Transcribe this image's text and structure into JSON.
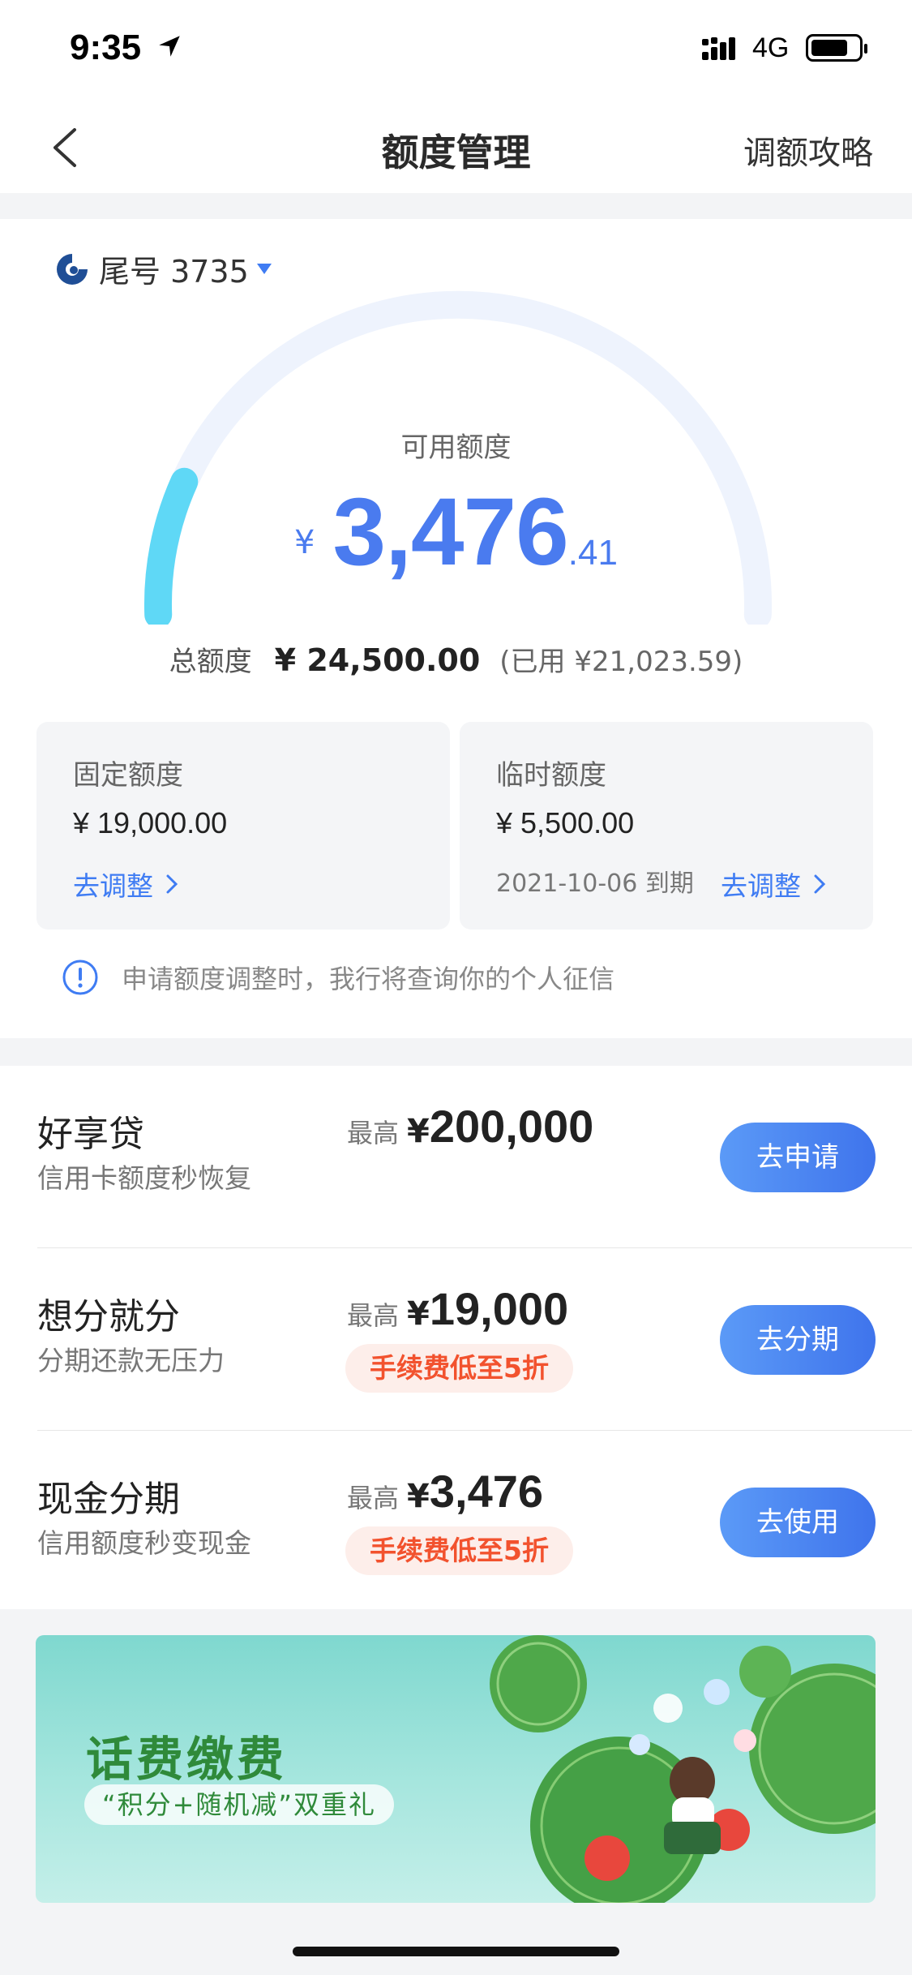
{
  "status_bar": {
    "time": "9:35",
    "network": "4G"
  },
  "nav": {
    "title": "额度管理",
    "right_link": "调额攻略"
  },
  "account": {
    "label": "尾号 3735"
  },
  "available": {
    "label": "可用额度",
    "currency": "¥",
    "integer": "3,476",
    "decimal": ".41",
    "fraction_of_total": 0.142
  },
  "total": {
    "label": "总额度",
    "value": "¥ 24,500.00",
    "used": "(已用 ¥21,023.59)"
  },
  "fixed": {
    "label": "固定额度",
    "value": "¥ 19,000.00",
    "link": "去调整"
  },
  "temp": {
    "label": "临时额度",
    "value": "¥ 5,500.00",
    "expiry": "2021-10-06 到期",
    "link": "去调整"
  },
  "notice": "申请额度调整时，我行将查询你的个人征信",
  "products": [
    {
      "name": "好享贷",
      "sub": "信用卡额度秒恢复",
      "prefix": "最高",
      "yen": "¥",
      "amount": "200,000",
      "tag": "",
      "button": "去申请"
    },
    {
      "name": "想分就分",
      "sub": "分期还款无压力",
      "prefix": "最高",
      "yen": "¥",
      "amount": "19,000",
      "tag": "手续费低至5折",
      "button": "去分期"
    },
    {
      "name": "现金分期",
      "sub": "信用额度秒变现金",
      "prefix": "最高",
      "yen": "¥",
      "amount": "3,476",
      "tag": "手续费低至5折",
      "button": "去使用"
    }
  ],
  "banner": {
    "title": "话费缴费",
    "subtitle": "“积分+随机减”双重礼"
  },
  "colors": {
    "accent": "#3f7cf3",
    "gauge_fill": "#5fd8f6",
    "gauge_track": "#eef3fd",
    "tag_text": "#f2522e"
  }
}
